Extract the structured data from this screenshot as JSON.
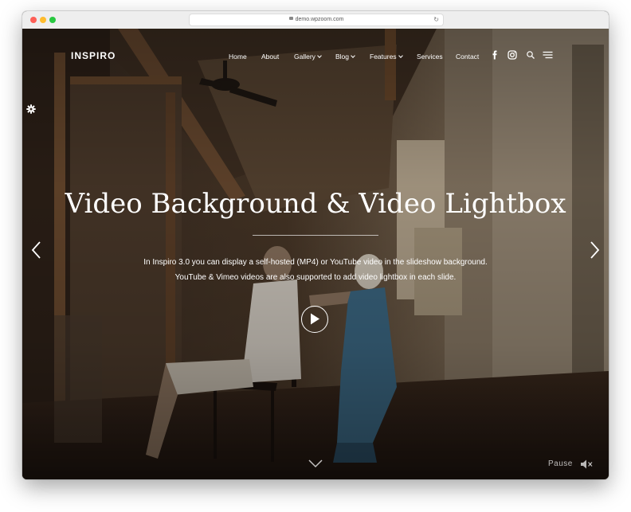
{
  "browser": {
    "url": "demo.wpzoom.com",
    "lock_icon": "lock-icon",
    "reload_icon": "reload-icon",
    "reload_glyph": "↻"
  },
  "site": {
    "brand": "INSPIRO",
    "nav": [
      {
        "label": "Home",
        "dropdown": false
      },
      {
        "label": "About",
        "dropdown": false
      },
      {
        "label": "Gallery",
        "dropdown": true
      },
      {
        "label": "Blog",
        "dropdown": true
      },
      {
        "label": "Features",
        "dropdown": true
      },
      {
        "label": "Services",
        "dropdown": false
      },
      {
        "label": "Contact",
        "dropdown": false
      }
    ],
    "nav_icons": [
      "facebook-icon",
      "instagram-icon",
      "search-icon",
      "menu-icon"
    ],
    "customizer_icon": "gear-icon"
  },
  "hero": {
    "title": "Video Background & Video Lightbox",
    "desc_line1": "In Inspiro 3.0 you can display a self-hosted (MP4) or YouTube video in the slideshow background.",
    "desc_line2": "YouTube & Vimeo videos are also supported to add video lightbox in each slide.",
    "play_icon": "play-icon",
    "prev_icon": "chevron-left-icon",
    "next_icon": "chevron-right-icon",
    "scroll_icon": "chevron-down-icon",
    "pause_label": "Pause",
    "mute_icon": "mute-icon"
  },
  "colors": {
    "text": "#ffffff",
    "titlebar": "#eeeeee",
    "close": "#fe5f57",
    "minimize": "#febc2e",
    "maximize": "#28c840"
  }
}
